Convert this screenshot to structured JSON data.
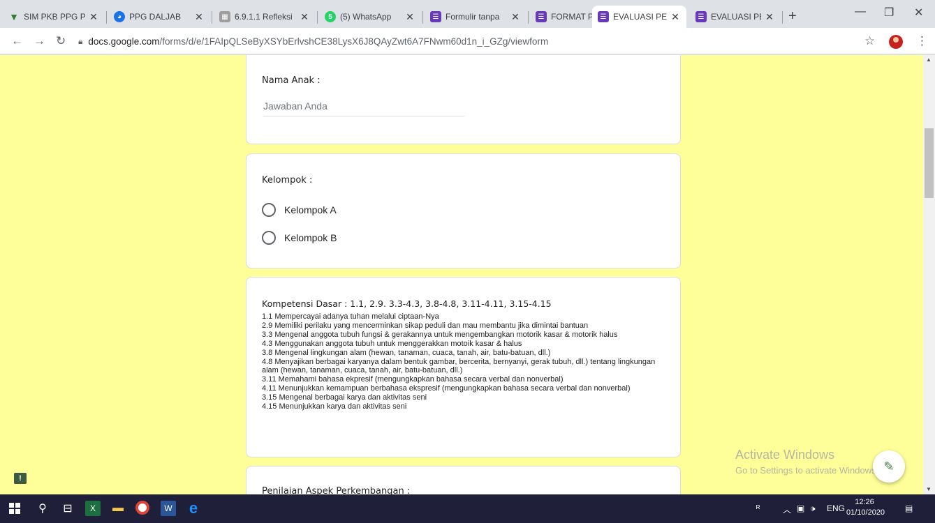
{
  "tabs": [
    {
      "title": "SIM PKB PPG PAI",
      "color": "#2e7d32",
      "glyph": "V"
    },
    {
      "title": "PPG DALJAB",
      "color": "#1a73e8",
      "glyph": "◕"
    },
    {
      "title": "6.9.1.1 Refleksi",
      "color": "#9e9e9e",
      "glyph": "▦"
    },
    {
      "title": "(5) WhatsApp",
      "color": "#25d366",
      "glyph": "5"
    },
    {
      "title": "Formulir tanpa",
      "color": "#673ab7",
      "glyph": "☰"
    },
    {
      "title": "FORMAT PENG",
      "color": "#673ab7",
      "glyph": "☰"
    },
    {
      "title": "EVALUASI PEM",
      "color": "#673ab7",
      "glyph": "☰"
    },
    {
      "title": "EVALUASI PEM",
      "color": "#673ab7",
      "glyph": "☰"
    }
  ],
  "window": {
    "new_tab": "+",
    "minimize": "—",
    "restore": "❐",
    "close": "✕"
  },
  "address": {
    "host": "docs.google.com",
    "path": "/forms/d/e/1FAIpQLSeByXSYbErlvshCE38LysX6J8QAyZwt6A7FNwm60d1n_i_GZg/viewform"
  },
  "form": {
    "nama": {
      "label": "Nama Anak :",
      "placeholder": "Jawaban Anda"
    },
    "kelompok": {
      "label": "Kelompok :",
      "options": [
        "Kelompok A",
        "Kelompok B"
      ]
    },
    "kd": {
      "title": "Kompetensi Dasar : 1.1, 2.9. 3.3-4.3, 3.8-4.8, 3.11-4.11, 3.15-4.15",
      "lines": [
        "1.1 Mempercayai adanya tuhan melalui ciptaan-Nya",
        "2.9 Memiliki perilaku yang mencerminkan sikap peduli dan mau membantu jika dimintai bantuan",
        "3.3 Mengenal anggota tubuh fungsi & gerakannya untuk mengembangkan motorik kasar & motorik halus",
        "4.3 Menggunakan anggota tubuh untuk menggerakkan motoik kasar & halus",
        "3.8 Mengenal lingkungan alam (hewan, tanaman, cuaca, tanah, air, batu-batuan, dll.)",
        "4.8 Menyajikan berbagai karyanya dalam bentuk gambar, bercerita, bernyanyi, gerak tubuh, dll.) tentang lingkungan alam (hewan, tanaman, cuaca, tanah, air, batu-batuan, dll.)",
        "3.11 Memahami bahasa ekpresif (mengungkapkan bahasa secara verbal dan nonverbal)",
        "4.11 Menunjukkan kemampuan berbahasa ekspresif (mengungkapkan bahasa secara verbal dan nonverbal)",
        "3.15 Mengenal berbagai karya dan aktivitas seni",
        "4.15 Menunjukkan karya dan aktivitas seni"
      ]
    },
    "penilaian": {
      "label": "Penilaian Aspek Perkembangan :"
    }
  },
  "watermark": {
    "line1": "Activate Windows",
    "line2": "Go to Settings to activate Windows."
  },
  "taskbar": {
    "lang": "ENG",
    "time": "12:26",
    "date": "01/10/2020"
  },
  "colors": {
    "page_bg": "#ffff99",
    "taskbar": "#1f1f3a"
  }
}
